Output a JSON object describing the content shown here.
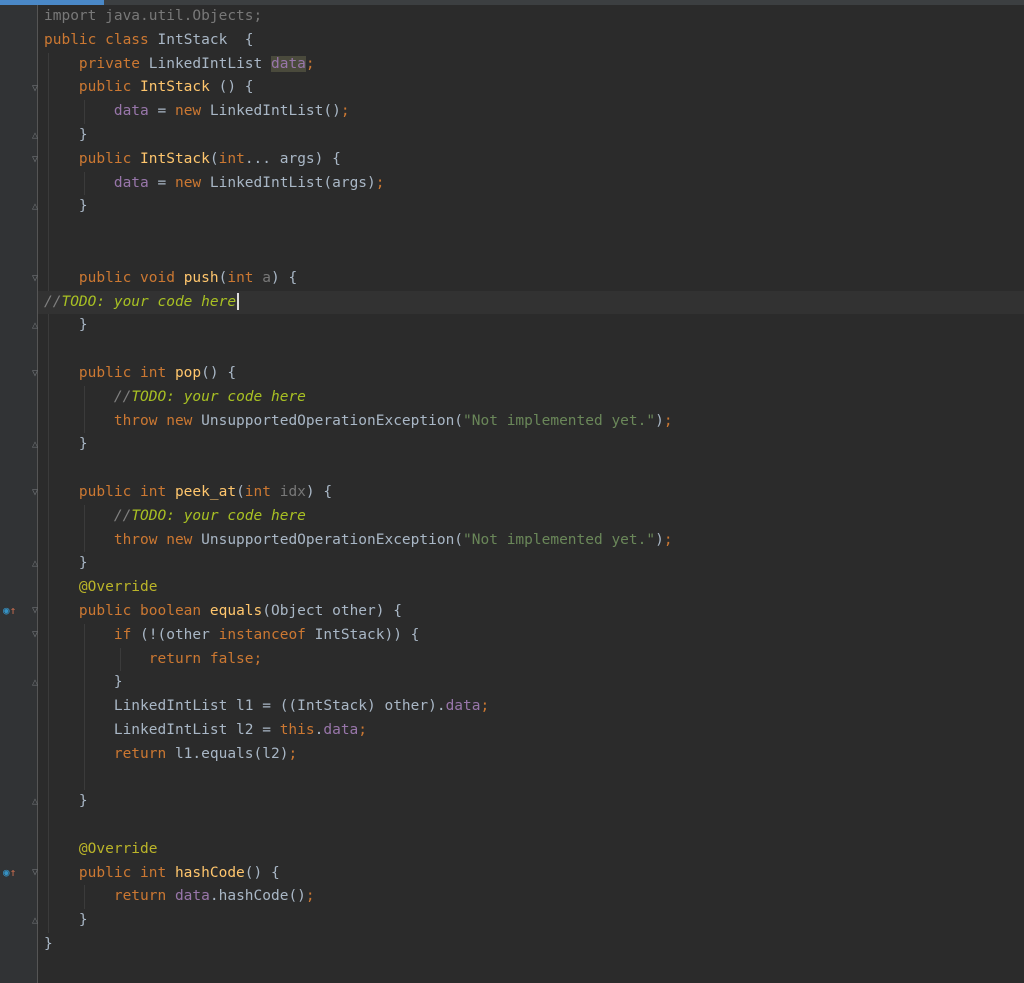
{
  "editor": {
    "file_progress_percent": 10,
    "gutter_override_icons": [
      "implement-override-icon",
      "implement-override-icon"
    ],
    "fold_icons": [
      "fold-start-icon",
      "fold-end-icon"
    ]
  },
  "code": {
    "l1": "import java.util.Objects;",
    "l2": {
      "t1": "public class ",
      "t2": "IntStack  {"
    },
    "l3": {
      "t1": "    private ",
      "t2": "LinkedIntList ",
      "t3": "data",
      "t4": ";"
    },
    "l4": {
      "t1": "    public ",
      "t2": "IntStack",
      "t3": " () {"
    },
    "l5": {
      "t1": "        ",
      "t2": "data",
      "t3": " = ",
      "t4": "new ",
      "t5": "LinkedIntList()",
      "t6": ";"
    },
    "l6": "    }",
    "l7": {
      "t1": "    public ",
      "t2": "IntStack",
      "t3": "(",
      "t4": "int",
      "t5": "... args) {"
    },
    "l8": {
      "t1": "        ",
      "t2": "data",
      "t3": " = ",
      "t4": "new ",
      "t5": "LinkedIntList(args)",
      "t6": ";"
    },
    "l9": "    }",
    "l12": {
      "t1": "    public void ",
      "t2": "push",
      "t3": "(",
      "t4": "int ",
      "t5": "a",
      "t6": ") {"
    },
    "l13": {
      "t1": "//",
      "t2": "TODO: your code here"
    },
    "l14": "    }",
    "l16": {
      "t1": "    public int ",
      "t2": "pop",
      "t3": "() {"
    },
    "l17": {
      "t1": "        //",
      "t2": "TODO: your code here"
    },
    "l18": {
      "t1": "        throw new ",
      "t2": "UnsupportedOperationException(",
      "t3": "\"Not implemented yet.\"",
      "t4": ")",
      "t5": ";"
    },
    "l19": "    }",
    "l21": {
      "t1": "    public int ",
      "t2": "peek_at",
      "t3": "(",
      "t4": "int ",
      "t5": "idx",
      "t6": ") {"
    },
    "l22": {
      "t1": "        //",
      "t2": "TODO: your code here"
    },
    "l23": {
      "t1": "        throw new ",
      "t2": "UnsupportedOperationException(",
      "t3": "\"Not implemented yet.\"",
      "t4": ")",
      "t5": ";"
    },
    "l24": "    }",
    "l25": "    @Override",
    "l26": {
      "t1": "    public boolean ",
      "t2": "equals",
      "t3": "(Object other) {"
    },
    "l27": {
      "t1": "        if ",
      "t2": "(!(other ",
      "t3": "instanceof ",
      "t4": "IntStack)) {"
    },
    "l28": "            return false;",
    "l29": "        }",
    "l30": {
      "t1": "        LinkedIntList l1 = ((IntStack) other).",
      "t2": "data",
      "t3": ";"
    },
    "l31": {
      "t1": "        LinkedIntList l2 = ",
      "t2": "this",
      "t3": ".",
      "t4": "data",
      "t5": ";"
    },
    "l32": {
      "t1": "        return ",
      "t2": "l1.equals(l2)",
      "t3": ";"
    },
    "l34": "    }",
    "l36": "    @Override",
    "l37": {
      "t1": "    public int ",
      "t2": "hashCode",
      "t3": "() {"
    },
    "l38": {
      "t1": "        return ",
      "t2": "data",
      "t3": ".hashCode()",
      "t4": ";"
    },
    "l39": "    }",
    "l40": "}"
  }
}
